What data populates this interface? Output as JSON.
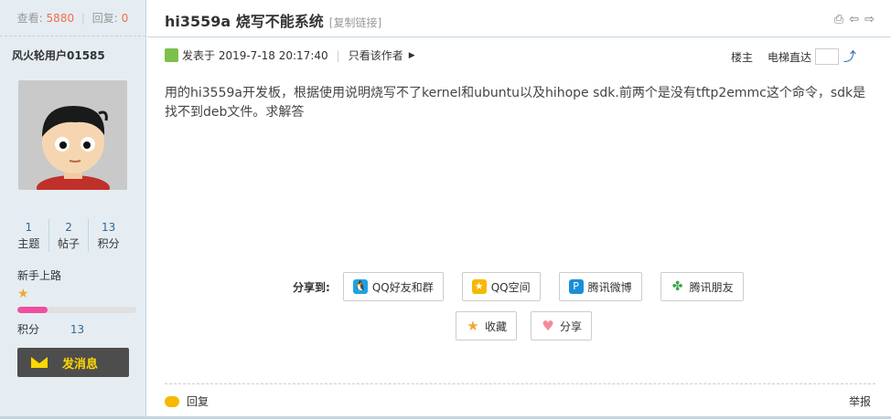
{
  "sidebar": {
    "views_label": "查看:",
    "views_value": "5880",
    "replies_label": "回复:",
    "replies_value": "0",
    "username": "风火轮用户01585",
    "stats": [
      {
        "value": "1",
        "label": "主题"
      },
      {
        "value": "2",
        "label": "帖子"
      },
      {
        "value": "13",
        "label": "积分"
      }
    ],
    "rank": "新手上路",
    "rank_progress_percent": 25,
    "score_label": "积分",
    "score_value": "13",
    "message_button": "发消息"
  },
  "post": {
    "title": "hi3559a 烧写不能系统",
    "copy_link": "[复制链接]",
    "posted_label": "发表于 2019-7-18 20:17:40",
    "only_author": "只看该作者",
    "floor_label": "楼主",
    "jump_label": "电梯直达",
    "content": "用的hi3559a开发板，根据使用说明烧写不了kernel和ubuntu以及hihope sdk.前两个是没有tftp2emmc这个命令，sdk是找不到deb文件。求解答",
    "share_label": "分享到:",
    "share_buttons": [
      {
        "label": "QQ好友和群",
        "icon": "qq-icon",
        "color": "#1aa3e6"
      },
      {
        "label": "QQ空间",
        "icon": "qzone-icon",
        "color": "#f6b800"
      },
      {
        "label": "腾讯微博",
        "icon": "tencent-weibo-icon",
        "color": "#1a8fd6"
      },
      {
        "label": "腾讯朋友",
        "icon": "clover-icon",
        "color": "#3aa845"
      }
    ],
    "favorite_label": "收藏",
    "share_button": "分享",
    "reply_label": "回复",
    "report_label": "举报"
  }
}
